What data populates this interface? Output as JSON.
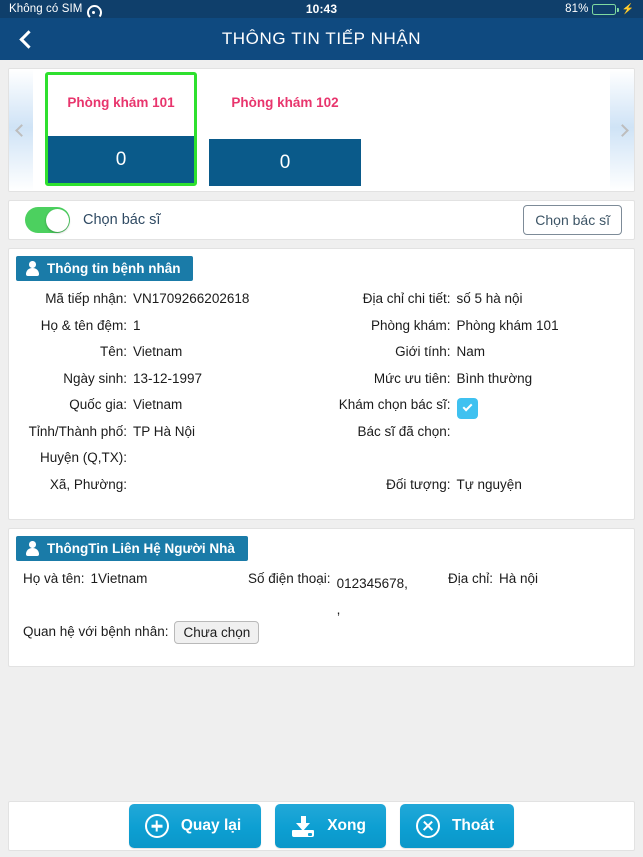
{
  "status_bar": {
    "carrier": "Không có SIM",
    "wifi_icon": "wifi-icon",
    "time": "10:43",
    "battery_percent": "81%",
    "battery_level": 81,
    "charging_icon": "lightning-bolt-icon"
  },
  "nav": {
    "back_icon": "chevron-left-icon",
    "title": "THÔNG TIN TIẾP NHẬN"
  },
  "rooms": {
    "prev_icon": "chevron-left-icon",
    "next_icon": "chevron-right-icon",
    "selected_index": 0,
    "items": [
      {
        "name": "Phòng khám 101",
        "count": "0",
        "selected": true
      },
      {
        "name": "Phòng khám 102",
        "count": "0",
        "selected": false
      }
    ]
  },
  "doctor_toggle": {
    "switch_state": "on",
    "label": "Chọn bác sĩ",
    "button_label": "Chọn bác sĩ"
  },
  "patient_section": {
    "icon": "person-icon",
    "title": "Thông tin bệnh nhân",
    "left_fields": [
      {
        "label": "Mã tiếp nhận:",
        "value": "VN1709266202618"
      },
      {
        "label": "Họ & tên đệm:",
        "value": "1"
      },
      {
        "label": "Tên:",
        "value": "Vietnam"
      },
      {
        "label": "Ngày sinh:",
        "value": "13-12-1997"
      },
      {
        "label": "Quốc gia:",
        "value": "Vietnam"
      },
      {
        "label": "Tỉnh/Thành phố:",
        "value": "TP Hà Nội"
      },
      {
        "label": "Huyện (Q,TX):",
        "value": ""
      },
      {
        "label": "Xã, Phường:",
        "value": ""
      }
    ],
    "right_fields": [
      {
        "label": "Địa chỉ chi tiết:",
        "value": "số 5 hà nội",
        "type": "text"
      },
      {
        "label": "Phòng khám:",
        "value": "Phòng khám 101",
        "type": "text"
      },
      {
        "label": "Giới tính:",
        "value": "Nam",
        "type": "text"
      },
      {
        "label": "Mức ưu tiên:",
        "value": "Bình thường",
        "type": "text"
      },
      {
        "label": "Khám chọn bác sĩ:",
        "value": "",
        "type": "checkbox",
        "checked": true
      },
      {
        "label": "Bác sĩ đã chọn:",
        "value": "",
        "type": "text"
      },
      {
        "label": "",
        "value": "",
        "type": "spacer"
      },
      {
        "label": "Đối tượng:",
        "value": "Tự nguyện",
        "type": "text"
      }
    ]
  },
  "contact_section": {
    "icon": "person-icon",
    "title": "ThôngTin Liên Hệ Người Nhà",
    "name_label": "Họ và tên:",
    "name_value": "1Vietnam",
    "phone_label": "Số điện thoại:",
    "phone_value_line1": "012345678,",
    "phone_value_line2": ",",
    "address_label": "Địa chỉ:",
    "address_value": "Hà nội",
    "relation_label": "Quan hệ với bệnh nhân:",
    "relation_button": "Chưa chọn"
  },
  "footer": {
    "buttons": [
      {
        "label": "Quay lại",
        "icon": "plus-circle-icon"
      },
      {
        "label": "Xong",
        "icon": "download-save-icon"
      },
      {
        "label": "Thoát",
        "icon": "close-circle-icon"
      }
    ]
  },
  "colors": {
    "navbar": "#0f4a80",
    "statusbar": "#0f3f6b",
    "room_name": "#e8356d",
    "room_count_bg": "#0a5a8a",
    "selected_border": "#2ee02e",
    "section_badge": "#1a7ba8",
    "toggle_on": "#4cd05f",
    "checkbox": "#3fc1f0",
    "action_button": "#0d9fd2",
    "page_bg": "#efefef"
  }
}
